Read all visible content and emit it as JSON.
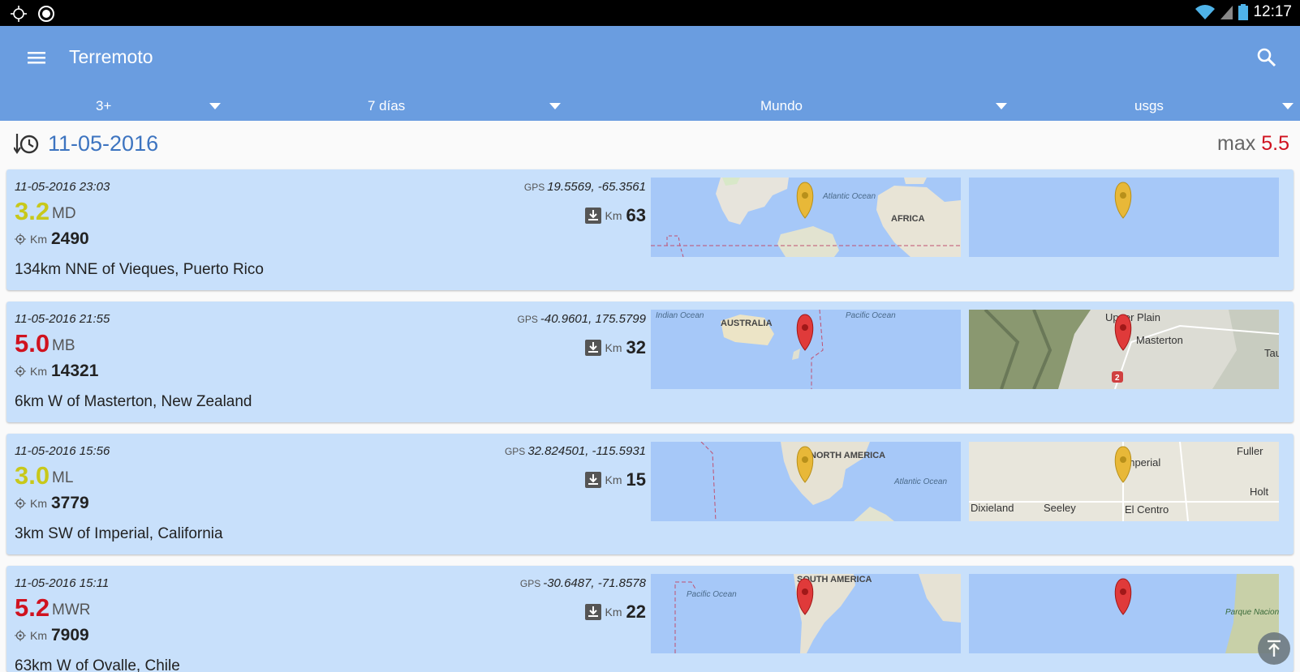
{
  "status_bar": {
    "time": "12:17"
  },
  "app_bar": {
    "title": "Terremoto"
  },
  "filters": [
    {
      "label": "3+"
    },
    {
      "label": "7 días"
    },
    {
      "label": "Mundo"
    },
    {
      "label": "usgs"
    }
  ],
  "date_header": {
    "date": "11-05-2016",
    "max_label": "max",
    "max_value": "5.5"
  },
  "units": {
    "km": "Km",
    "gps": "GPS"
  },
  "colors": {
    "yellow_mag": "#c8c81a",
    "red_mag": "#d0121f",
    "accent": "#6a9de0",
    "card": "#c8e0fb"
  },
  "quakes": [
    {
      "time": "11-05-2016 23:03",
      "magnitude": "3.2",
      "mag_type": "MD",
      "distance": "2490",
      "place": "134km NNE of Vieques, Puerto Rico",
      "gps": "19.5569, -65.3561",
      "depth": "63",
      "severity": "yellow"
    },
    {
      "time": "11-05-2016 21:55",
      "magnitude": "5.0",
      "mag_type": "MB",
      "distance": "14321",
      "place": "6km W of Masterton, New Zealand",
      "gps": "-40.9601, 175.5799",
      "depth": "32",
      "severity": "red"
    },
    {
      "time": "11-05-2016 15:56",
      "magnitude": "3.0",
      "mag_type": "ML",
      "distance": "3779",
      "place": "3km SW of Imperial, California",
      "gps": "32.824501, -115.5931",
      "depth": "15",
      "severity": "yellow"
    },
    {
      "time": "11-05-2016 15:11",
      "magnitude": "5.2",
      "mag_type": "MWR",
      "distance": "7909",
      "place": "63km W of Ovalle, Chile",
      "gps": "-30.6487, -71.8578",
      "depth": "22",
      "severity": "red"
    }
  ],
  "map_labels": {
    "q1_world": [
      "Atlantic Ocean",
      "AFRICA"
    ],
    "q2_world": [
      "Indian Ocean",
      "AUSTRALIA",
      "Pacific Ocean"
    ],
    "q2_local": [
      "Upper Plain",
      "Masterton",
      "Tau",
      "2"
    ],
    "q3_world": [
      "NORTH AMERICA",
      "Atlantic Ocean"
    ],
    "q3_local": [
      "Imperial",
      "Fuller",
      "Holt",
      "Dixieland",
      "Seeley",
      "El Centro"
    ],
    "q4_world": [
      "Pacific Ocean",
      "SOUTH AMERICA"
    ],
    "q4_local": [
      "Parque Nacional Fray Jorge"
    ]
  }
}
